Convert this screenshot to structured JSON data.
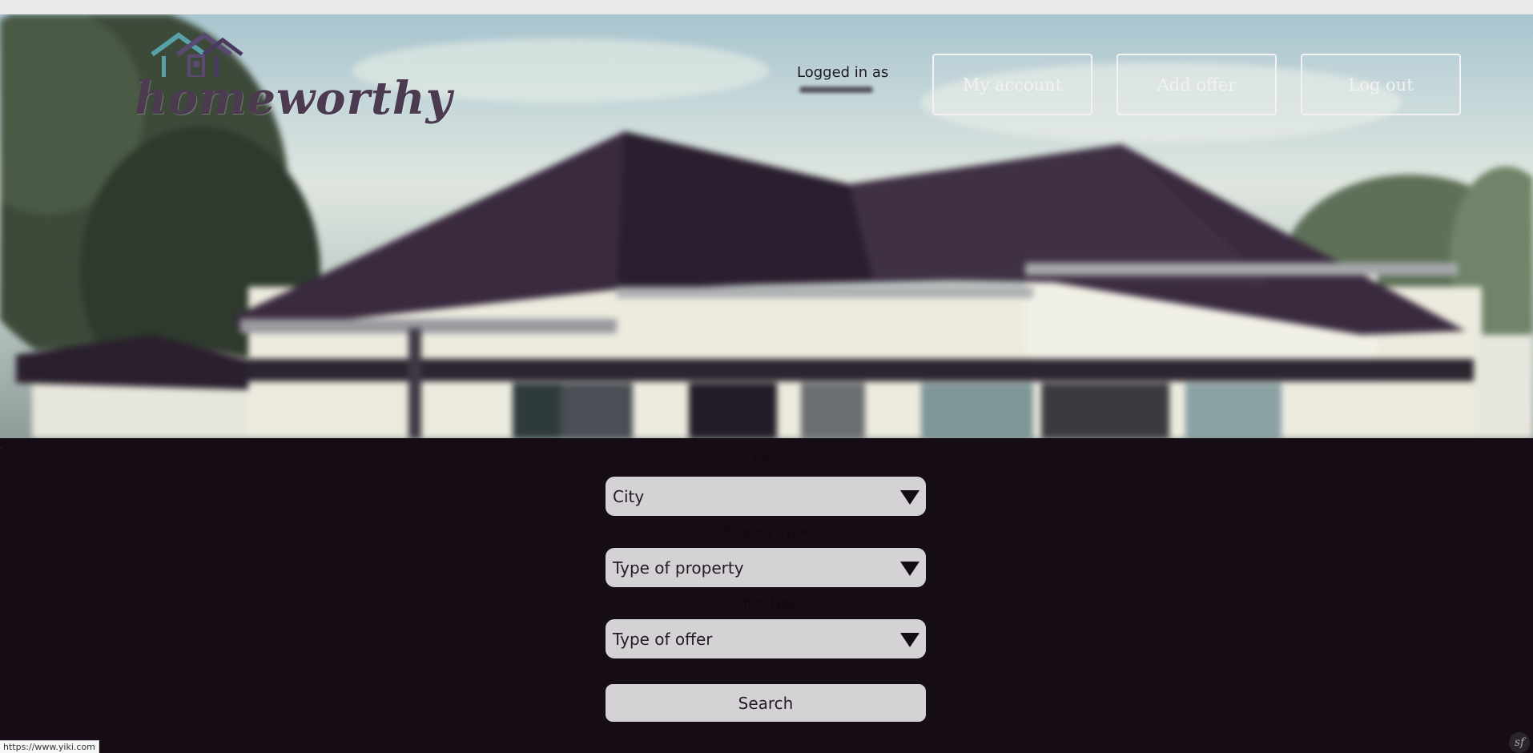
{
  "header": {
    "logo_text": "homeworthy",
    "logged_in_label": "Logged in as",
    "nav": {
      "my_account": "My account",
      "add_offer": "Add offer",
      "log_out": "Log out"
    }
  },
  "search_form": {
    "city": {
      "label": "City",
      "value": "City"
    },
    "property_type": {
      "label": "Property_type",
      "value": "Type of property"
    },
    "offer_type": {
      "label": "Offer_type",
      "value": "Type of offer"
    },
    "submit_label": "Search"
  },
  "status_bar": {
    "url": "https://www.yiki.com"
  },
  "icons": {
    "logo": "house-roof-icon",
    "dropdown": "triangle-down-icon",
    "debug": "symfony-icon"
  },
  "colors": {
    "page_background": "#150c15",
    "field_background": "#d4d2d4",
    "nav_border": "#f2f2f2"
  }
}
